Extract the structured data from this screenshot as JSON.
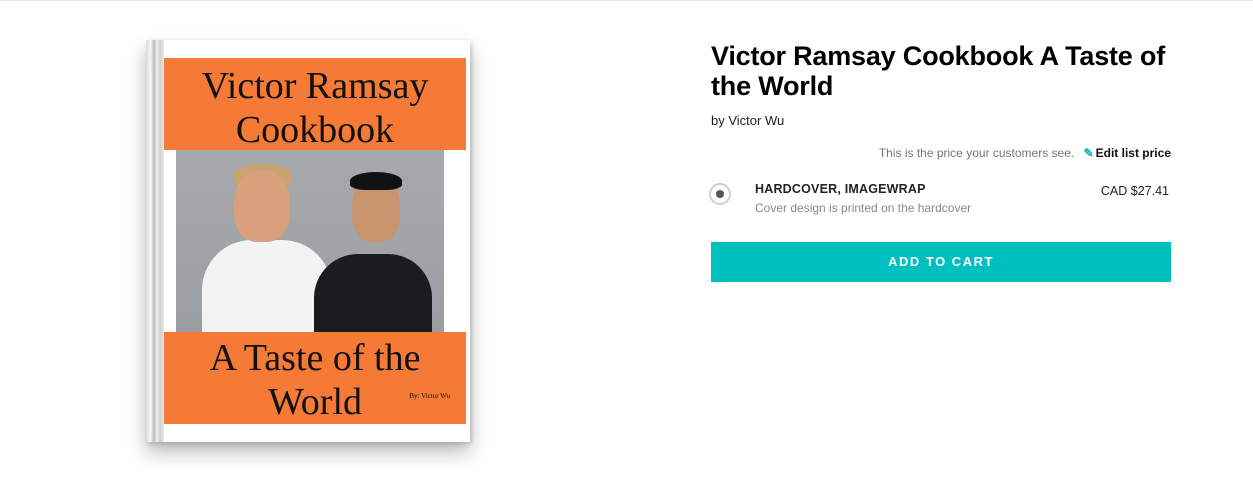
{
  "book": {
    "cover_title": "Victor Ramsay Cookbook",
    "cover_subtitle": "A Taste of the World",
    "cover_byline": "By: Victor Wu"
  },
  "product": {
    "title": "Victor Ramsay Cookbook A Taste of the World",
    "author": "by Victor Wu",
    "price_note": "This is the price your customers see.",
    "edit_price_label": "Edit list price",
    "option": {
      "name": "HARDCOVER, IMAGEWRAP",
      "description": "Cover design is printed on the hardcover",
      "price": "CAD $27.41",
      "selected": true
    },
    "add_to_cart_label": "ADD TO CART"
  },
  "colors": {
    "accent": "#00bfbf",
    "cover_band": "#f47a35"
  },
  "icons": {
    "edit": "pencil-icon",
    "option_select": "radio-selected"
  }
}
